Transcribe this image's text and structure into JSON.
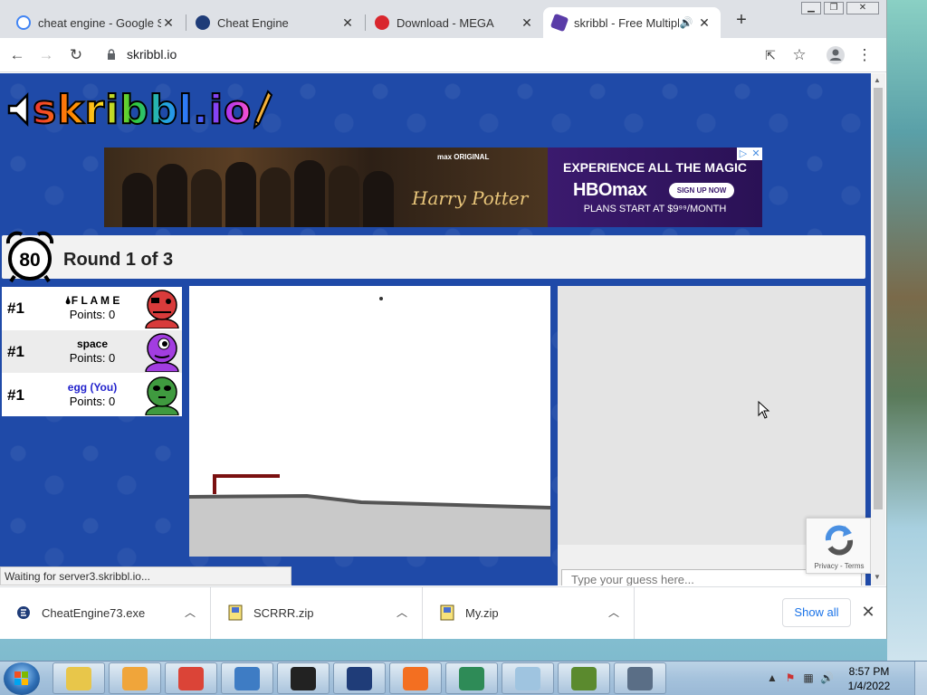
{
  "browser": {
    "tabs": [
      {
        "title": "cheat engine - Google Se",
        "favicon": "google-icon",
        "color": "#4285f4"
      },
      {
        "title": "Cheat Engine",
        "favicon": "cheat-engine-icon",
        "color": "#1f3c78"
      },
      {
        "title": "Download - MEGA",
        "favicon": "mega-icon",
        "color": "#d9272e"
      },
      {
        "title": "skribbl - Free Multipl",
        "favicon": "skribbl-icon",
        "color": "#5a3ca8",
        "active": true
      }
    ],
    "new_tab_symbol": "+",
    "url": "skribbl.io"
  },
  "page": {
    "logo_text": "skribbl.io",
    "ad": {
      "max_original": "max ORIGINAL",
      "hp_title": "Harry Potter",
      "headline": "EXPERIENCE ALL THE MAGIC",
      "brand": "HBOmax",
      "signup": "SIGN UP NOW",
      "plans": "PLANS START AT $9⁹⁹/MONTH"
    },
    "timer": "80",
    "round_text": "Round 1 of 3",
    "players": [
      {
        "rank": "#1",
        "name": "🌢F L A M E",
        "points": "Points: 0",
        "you": false,
        "avatar_color": "#d83b3b"
      },
      {
        "rank": "#1",
        "name": "space",
        "points": "Points: 0",
        "you": false,
        "avatar_color": "#a23de0"
      },
      {
        "rank": "#1",
        "name": "egg (You)",
        "points": "Points: 0",
        "you": true,
        "avatar_color": "#3f9a3f"
      }
    ],
    "guess_placeholder": "Type your guess here...",
    "recaptcha_links": "Privacy - Terms",
    "status": "Waiting for server3.skribbl.io..."
  },
  "downloads": {
    "items": [
      {
        "name": "CheatEngine73.exe",
        "icon": "cheat-engine-icon"
      },
      {
        "name": "SCRRR.zip",
        "icon": "zip-icon"
      },
      {
        "name": "My.zip",
        "icon": "zip-icon"
      }
    ],
    "show_all": "Show all"
  },
  "taskbar": {
    "apps": [
      {
        "name": "explorer-icon",
        "color": "#e8c64a"
      },
      {
        "name": "media-player-icon",
        "color": "#f0a53a"
      },
      {
        "name": "chrome-icon",
        "color": "#db4437"
      },
      {
        "name": "control-panel-icon",
        "color": "#3e7cc4"
      },
      {
        "name": "7zip-icon",
        "color": "#222222"
      },
      {
        "name": "cheat-engine-icon",
        "color": "#1f3c78"
      },
      {
        "name": "vpn-icon",
        "color": "#f36f21"
      },
      {
        "name": "task-manager-icon",
        "color": "#2e8b57"
      },
      {
        "name": "notepad-icon",
        "color": "#9fc4e0"
      },
      {
        "name": "minecraft-icon",
        "color": "#5b8a2e"
      },
      {
        "name": "window-icon",
        "color": "#5a6e86"
      }
    ],
    "time": "8:57 PM",
    "date": "1/4/2022"
  }
}
